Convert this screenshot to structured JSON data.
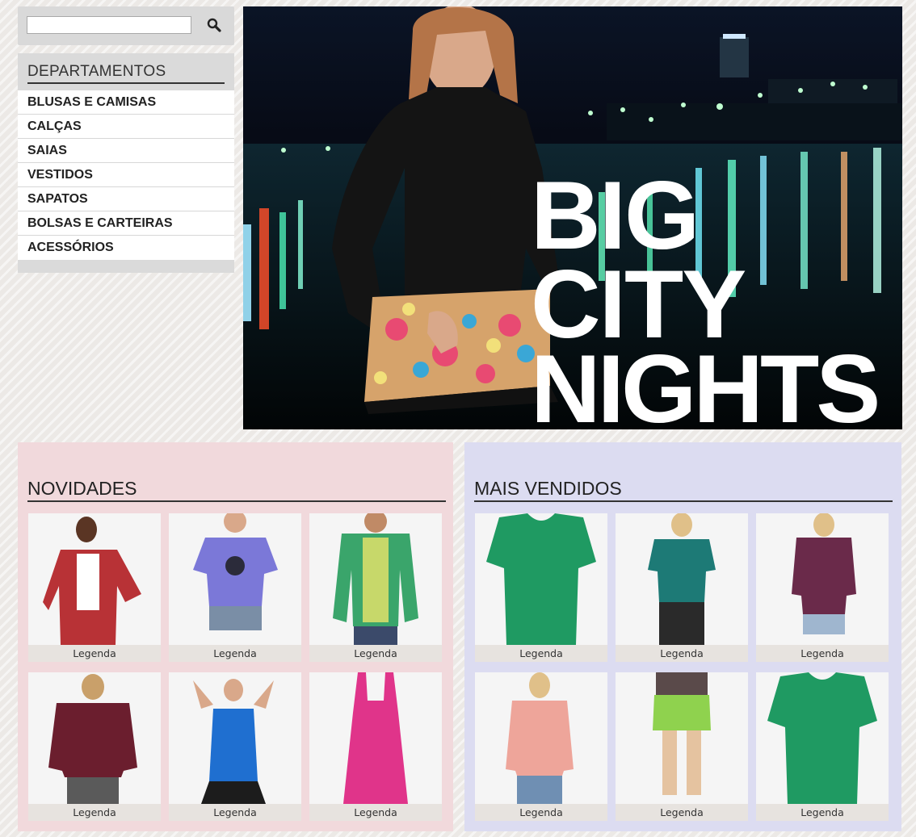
{
  "search": {
    "value": "",
    "placeholder": "",
    "icon": "search-icon"
  },
  "departments": {
    "title": "DEPARTAMENTOS",
    "items": [
      {
        "label": "BLUSAS E CAMISAS"
      },
      {
        "label": "CALÇAS"
      },
      {
        "label": "SAIAS"
      },
      {
        "label": "VESTIDOS"
      },
      {
        "label": "SAPATOS"
      },
      {
        "label": "BOLSAS E CARTEIRAS"
      },
      {
        "label": "ACESSÓRIOS"
      }
    ]
  },
  "hero": {
    "lines": [
      "BIG",
      "CITY",
      "NIGHTS"
    ]
  },
  "novidades": {
    "title": "NOVIDADES",
    "products": [
      {
        "caption": "Legenda",
        "color": "#b83236"
      },
      {
        "caption": "Legenda",
        "color": "#7b78d8"
      },
      {
        "caption": "Legenda",
        "color": "#3aa56b"
      },
      {
        "caption": "Legenda",
        "color": "#6b1e2e"
      },
      {
        "caption": "Legenda",
        "color": "#1f6fd0"
      },
      {
        "caption": "Legenda",
        "color": "#e0348a"
      }
    ]
  },
  "mais_vendidos": {
    "title": "MAIS VENDIDOS",
    "products": [
      {
        "caption": "Legenda",
        "color": "#1f9a62"
      },
      {
        "caption": "Legenda",
        "color": "#1d7a76"
      },
      {
        "caption": "Legenda",
        "color": "#6a2a4a"
      },
      {
        "caption": "Legenda",
        "color": "#eea59a"
      },
      {
        "caption": "Legenda",
        "color": "#8fd24e"
      },
      {
        "caption": "Legenda",
        "color": "#1f9a62"
      }
    ]
  }
}
